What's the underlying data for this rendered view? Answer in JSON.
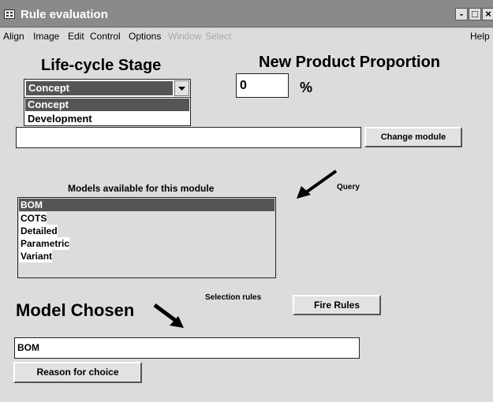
{
  "window": {
    "title": "Rule evaluation",
    "controls": {
      "minimize": "-",
      "maximize": "□",
      "close": "×"
    }
  },
  "menubar": {
    "items": [
      {
        "label": "Align",
        "enabled": true
      },
      {
        "label": "Image",
        "enabled": true
      },
      {
        "label": "Edit",
        "enabled": true
      },
      {
        "label": "Control",
        "enabled": true
      },
      {
        "label": "Options",
        "enabled": true
      },
      {
        "label": "Window",
        "enabled": false
      },
      {
        "label": "Select",
        "enabled": false
      }
    ],
    "help": "Help"
  },
  "lifecycle": {
    "label": "Life-cycle Stage",
    "selected": "Concept",
    "options": [
      "Concept",
      "Development"
    ]
  },
  "proportion": {
    "label": "New Product Proportion",
    "value": "0",
    "unit": "%"
  },
  "module": {
    "value": "",
    "button": "Change module"
  },
  "models": {
    "label": "Models available for this module",
    "items": [
      "BOM",
      "COTS",
      "Detailed",
      "Parametric",
      "Variant"
    ],
    "selected_index": 0
  },
  "query": {
    "label": "Query"
  },
  "selection_rules": {
    "label": "Selection rules"
  },
  "fire": {
    "button": "Fire Rules"
  },
  "chosen": {
    "label": "Model Chosen",
    "value": "BOM",
    "reason_button": "Reason for choice"
  },
  "colors": {
    "titlebar": "#8a8a8a",
    "window_bg": "#dcdcdc",
    "selection": "#555555"
  }
}
